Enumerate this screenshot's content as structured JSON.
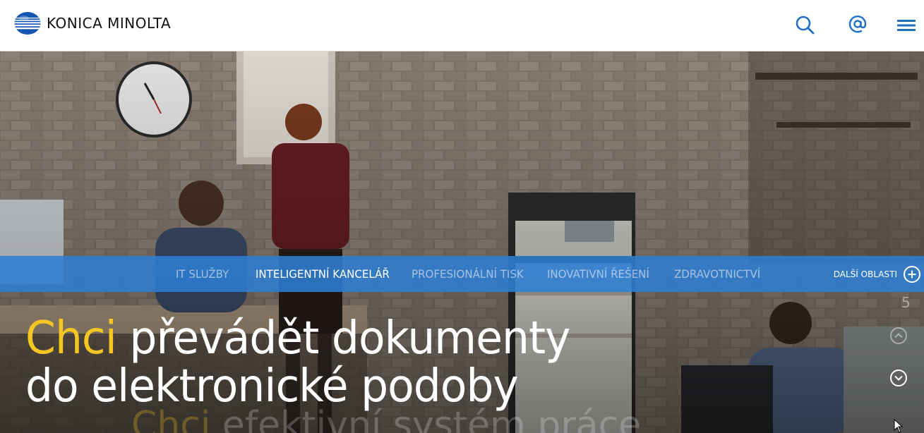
{
  "brand": {
    "name": "KONICA MINOLTA"
  },
  "header": {
    "icons": [
      "search-icon",
      "at-sign-icon",
      "hamburger-menu-icon"
    ],
    "accent_color": "#1f6fc5"
  },
  "tabs": [
    {
      "label": "IT SLUŽBY",
      "active": false
    },
    {
      "label": "INTELIGENTNÍ KANCELÁŘ",
      "active": true
    },
    {
      "label": "PROFESIONÁLNÍ TISK",
      "active": false
    },
    {
      "label": "INOVATIVNÍ ŘEŠENÍ",
      "active": false
    },
    {
      "label": "ZDRAVOTNICTVÍ",
      "active": false
    }
  ],
  "more_areas": {
    "label": "DALŠÍ OBLASTI",
    "icon": "plus-circle-icon"
  },
  "headline": {
    "accent": "Chci",
    "line1_rest": "převádět dokumenty",
    "line2": "do elektronické podoby"
  },
  "next_headline": {
    "accent": "Chci",
    "rest": "efektivní systém práce"
  },
  "slider": {
    "counter": "5",
    "up_icon": "chevron-up-circle-icon",
    "down_icon": "chevron-down-circle-icon"
  },
  "colors": {
    "tab_bar": "#2d7dd2",
    "headline_accent": "#f3c623"
  }
}
